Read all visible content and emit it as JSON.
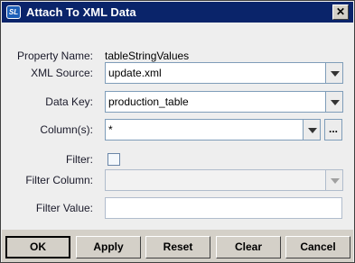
{
  "window": {
    "title": "Attach To XML Data",
    "icon_text": "SL",
    "close_glyph": "✕"
  },
  "form": {
    "property_name": {
      "label": "Property Name:",
      "value": "tableStringValues"
    },
    "xml_source": {
      "label": "XML Source:",
      "value": "update.xml"
    },
    "data_key": {
      "label": "Data Key:",
      "value": "production_table"
    },
    "columns": {
      "label": "Column(s):",
      "value": "*",
      "browse_label": "..."
    },
    "filter": {
      "label": "Filter:",
      "checked": false
    },
    "filter_column": {
      "label": "Filter Column:",
      "value": ""
    },
    "filter_value": {
      "label": "Filter Value:",
      "value": ""
    }
  },
  "buttons": {
    "ok": "OK",
    "apply": "Apply",
    "reset": "Reset",
    "clear": "Clear",
    "cancel": "Cancel"
  },
  "icons": {
    "combo": "chevron-down-icon",
    "close": "close-icon",
    "app": "app-logo-icon"
  }
}
